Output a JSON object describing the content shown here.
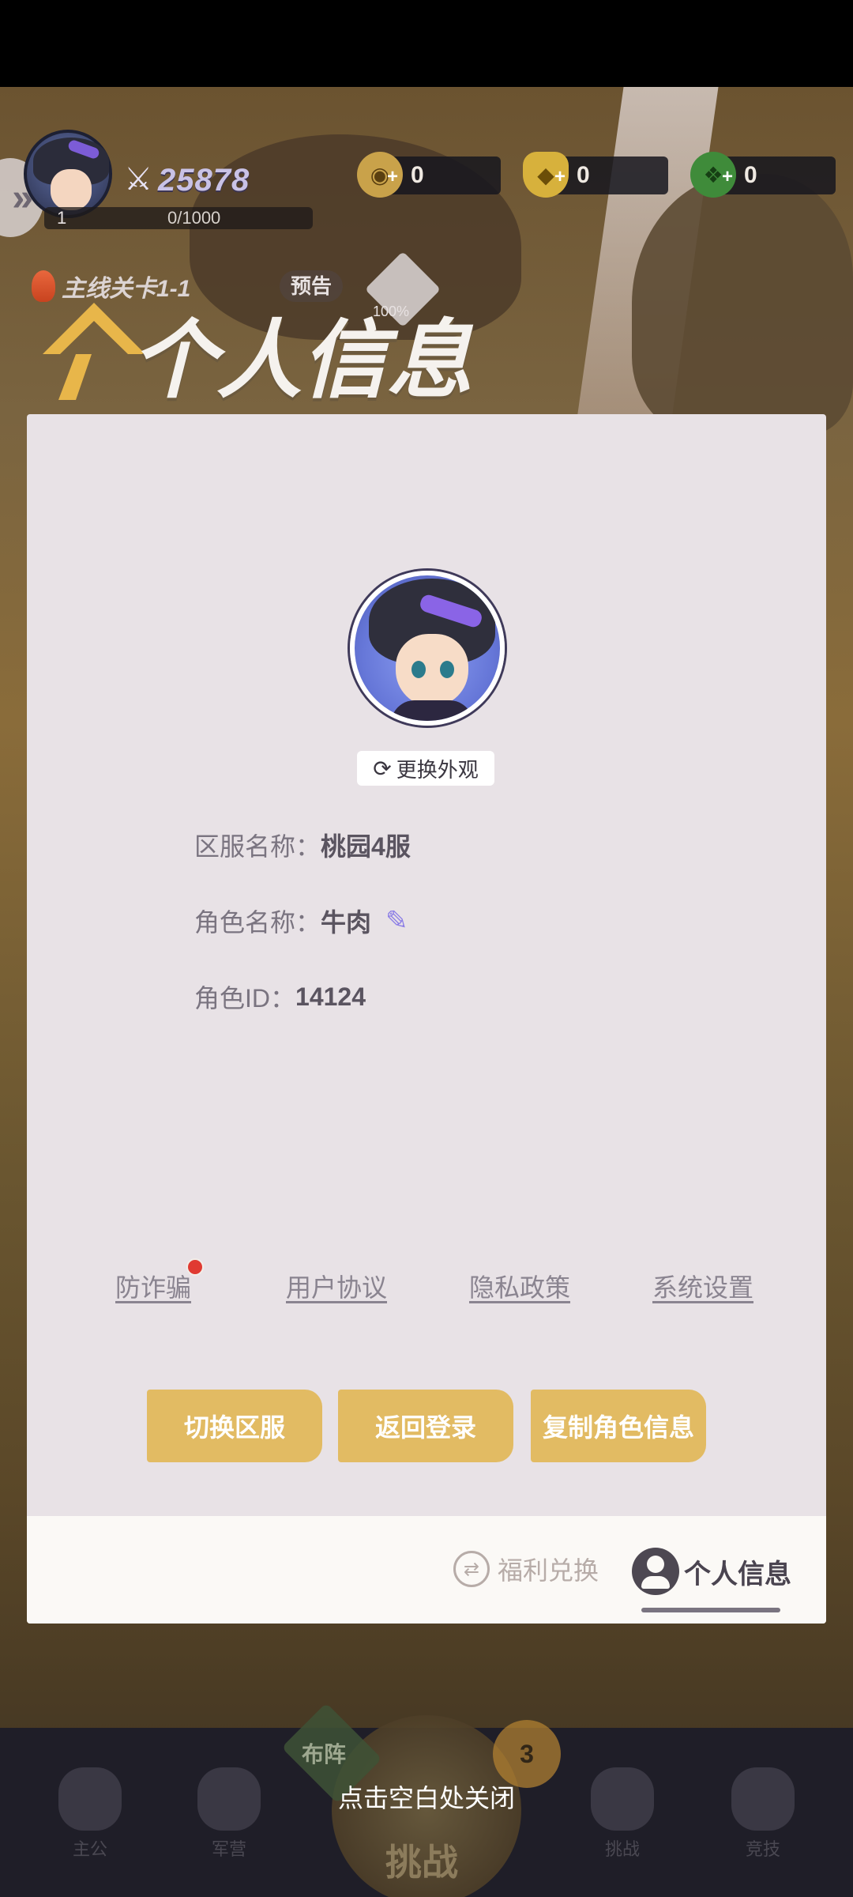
{
  "hud": {
    "power": "25878",
    "level": "1",
    "exp": "0/1000",
    "currencies": [
      {
        "icon": "copper-coin-icon",
        "value": "0"
      },
      {
        "icon": "gold-ingot-icon",
        "value": "0"
      },
      {
        "icon": "jade-icon",
        "value": "0"
      }
    ],
    "quest": "主线关卡1-1",
    "preview": "预告",
    "gift_pct": "100%"
  },
  "modal": {
    "title": "个人信息",
    "change_appearance": "更换外观",
    "server_label": "区服名称：",
    "server_value": "桃园4服",
    "role_label": "角色名称：",
    "role_value": "牛肉",
    "id_label": "角色ID：",
    "id_value": "14124",
    "links": [
      "防诈骗",
      "用户协议",
      "隐私政策",
      "系统设置"
    ],
    "buttons": [
      "切换区服",
      "返回登录",
      "复制角色信息"
    ],
    "tabs": {
      "welfare": "福利兑换",
      "personal": "个人信息"
    }
  },
  "bottom": {
    "nav": [
      "主公",
      "军营",
      "挑战",
      "挑战",
      "竞技"
    ],
    "formation": "布阵",
    "bubble": "3",
    "close_hint": "点击空白处关闭"
  },
  "colors": {
    "panel_bg": "#e8e2e6",
    "button": "#e2bb63",
    "accent_purple": "#8c7ee6",
    "alert_dot": "#e03a32"
  }
}
